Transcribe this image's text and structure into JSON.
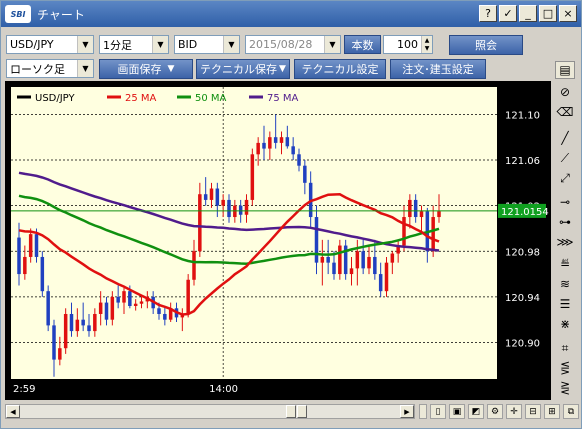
{
  "window": {
    "title": "チャート",
    "logo_text": "SBI",
    "controls": [
      "?",
      "✓",
      "_",
      "□",
      "×"
    ]
  },
  "toolbar1": {
    "symbol": "USD/JPY",
    "interval": "1分足",
    "price_type": "BID",
    "date": "2015/08/28",
    "count_label": "本数",
    "count_value": "100",
    "query_button": "照会"
  },
  "toolbar2": {
    "chart_type": "ローソク足",
    "save_screen": "画面保存",
    "save_tech": "テクニカル保存",
    "tech_settings": "テクニカル設定",
    "order_settings": "注文･建玉設定"
  },
  "legend": [
    {
      "label": "USD/JPY",
      "color": "#000000"
    },
    {
      "label": "25 MA",
      "color": "#e01010"
    },
    {
      "label": "50 MA",
      "color": "#109010"
    },
    {
      "label": "75 MA",
      "color": "#501c8c"
    }
  ],
  "current_price": "121.0154",
  "colors": {
    "plot_bg": "#ffffe0",
    "up": "#e01010",
    "down": "#2040c0",
    "price_line": "#109010",
    "price_tag_bg": "#10a020"
  },
  "chart_data": {
    "type": "candlestick",
    "y_ticks": [
      121.1,
      121.06,
      121.02,
      120.98,
      120.94,
      120.9
    ],
    "y_tick_labels": [
      "121.10",
      "121.06",
      "121.02",
      "120.98",
      "120.94",
      "120.90"
    ],
    "ylim": [
      120.868,
      121.124
    ],
    "x_tick_labels": [
      "2:59",
      "14:00"
    ],
    "grid": true,
    "current_price": 121.0154,
    "candles": [
      [
        120.992,
        121.005,
        120.95,
        120.96
      ],
      [
        120.96,
        120.985,
        120.955,
        120.975
      ],
      [
        120.975,
        121.0,
        120.97,
        120.995
      ],
      [
        120.995,
        121.0,
        120.97,
        120.975
      ],
      [
        120.975,
        120.98,
        120.94,
        120.945
      ],
      [
        120.945,
        120.95,
        120.91,
        120.915
      ],
      [
        120.915,
        120.92,
        120.87,
        120.885
      ],
      [
        120.885,
        120.905,
        120.88,
        120.895
      ],
      [
        120.895,
        120.93,
        120.89,
        120.925
      ],
      [
        120.925,
        120.935,
        120.905,
        120.91
      ],
      [
        120.91,
        120.93,
        120.905,
        120.92
      ],
      [
        120.92,
        120.935,
        120.91,
        120.915
      ],
      [
        120.915,
        120.925,
        120.905,
        120.91
      ],
      [
        120.91,
        120.93,
        120.905,
        120.925
      ],
      [
        120.925,
        120.945,
        120.915,
        120.935
      ],
      [
        120.935,
        120.94,
        120.915,
        120.92
      ],
      [
        120.92,
        120.945,
        120.915,
        120.94
      ],
      [
        120.94,
        120.95,
        120.93,
        120.935
      ],
      [
        120.935,
        120.948,
        120.925,
        120.945
      ],
      [
        120.945,
        120.95,
        120.93,
        120.932
      ],
      [
        120.932,
        120.938,
        120.928,
        120.934
      ],
      [
        120.934,
        120.94,
        120.93,
        120.936
      ],
      [
        120.936,
        120.945,
        120.93,
        120.94
      ],
      [
        120.94,
        120.945,
        120.925,
        120.93
      ],
      [
        120.93,
        120.935,
        120.92,
        120.925
      ],
      [
        120.925,
        120.932,
        120.915,
        120.92
      ],
      [
        120.92,
        120.935,
        120.918,
        120.93
      ],
      [
        120.93,
        120.935,
        120.918,
        120.922
      ],
      [
        120.922,
        120.93,
        120.91,
        120.925
      ],
      [
        120.925,
        120.96,
        120.922,
        120.955
      ],
      [
        120.955,
        120.99,
        120.95,
        120.98
      ],
      [
        120.98,
        121.04,
        120.975,
        121.03
      ],
      [
        121.03,
        121.045,
        121.02,
        121.025
      ],
      [
        121.025,
        121.04,
        121.018,
        121.035
      ],
      [
        121.035,
        121.04,
        121.01,
        121.02
      ],
      [
        121.02,
        121.03,
        121.01,
        121.025
      ],
      [
        121.025,
        121.03,
        121.005,
        121.01
      ],
      [
        121.01,
        121.025,
        121.005,
        121.02
      ],
      [
        121.02,
        121.025,
        121.005,
        121.012
      ],
      [
        121.012,
        121.03,
        121.005,
        121.025
      ],
      [
        121.025,
        121.07,
        121.02,
        121.065
      ],
      [
        121.065,
        121.08,
        121.055,
        121.075
      ],
      [
        121.075,
        121.09,
        121.06,
        121.07
      ],
      [
        121.07,
        121.085,
        121.06,
        121.08
      ],
      [
        121.08,
        121.1,
        121.07,
        121.075
      ],
      [
        121.075,
        121.085,
        121.065,
        121.08
      ],
      [
        121.08,
        121.09,
        121.07,
        121.072
      ],
      [
        121.072,
        121.08,
        121.06,
        121.065
      ],
      [
        121.065,
        121.07,
        121.05,
        121.055
      ],
      [
        121.055,
        121.06,
        121.03,
        121.04
      ],
      [
        121.04,
        121.05,
        121.0,
        121.01
      ],
      [
        121.01,
        121.02,
        120.96,
        120.97
      ],
      [
        120.97,
        120.99,
        120.95,
        120.975
      ],
      [
        120.975,
        120.99,
        120.96,
        120.97
      ],
      [
        120.97,
        120.98,
        120.955,
        120.96
      ],
      [
        120.96,
        120.99,
        120.955,
        120.985
      ],
      [
        120.985,
        120.99,
        120.955,
        120.96
      ],
      [
        120.96,
        120.975,
        120.95,
        120.965
      ],
      [
        120.965,
        120.99,
        120.95,
        120.98
      ],
      [
        120.98,
        120.99,
        120.96,
        120.965
      ],
      [
        120.965,
        120.985,
        120.96,
        120.975
      ],
      [
        120.975,
        120.99,
        120.955,
        120.96
      ],
      [
        120.96,
        120.97,
        120.94,
        120.945
      ],
      [
        120.945,
        120.975,
        120.94,
        120.97
      ],
      [
        120.97,
        120.98,
        120.96,
        120.978
      ],
      [
        120.978,
        120.99,
        120.97,
        120.985
      ],
      [
        120.985,
        121.02,
        120.98,
        121.01
      ],
      [
        121.01,
        121.03,
        121.0,
        121.025
      ],
      [
        121.025,
        121.03,
        121.005,
        121.01
      ],
      [
        121.01,
        121.02,
        120.995,
        121.015
      ],
      [
        121.015,
        121.018,
        120.97,
        120.98
      ],
      [
        120.98,
        121.02,
        120.975,
        121.01
      ],
      [
        121.01,
        121.03,
        121.005,
        121.015
      ]
    ]
  }
}
